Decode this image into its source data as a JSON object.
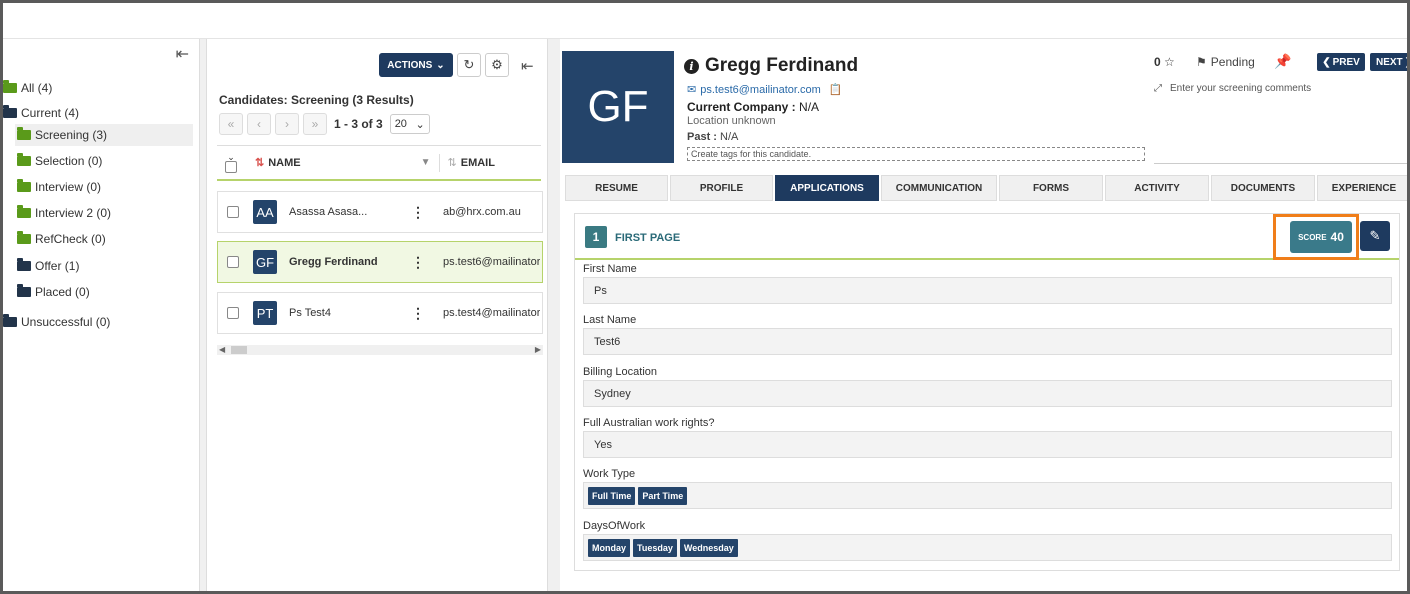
{
  "folders": {
    "items": [
      {
        "label": "All (4)",
        "color": "green"
      },
      {
        "label": "Current (4)",
        "color": "dark"
      },
      {
        "label": "Screening (3)",
        "color": "green",
        "active": true
      },
      {
        "label": "Selection (0)",
        "color": "green"
      },
      {
        "label": "Interview (0)",
        "color": "green"
      },
      {
        "label": "Interview 2 (0)",
        "color": "green"
      },
      {
        "label": "RefCheck (0)",
        "color": "green"
      },
      {
        "label": "Offer (1)",
        "color": "dark"
      },
      {
        "label": "Placed (0)",
        "color": "dark"
      },
      {
        "label": "Unsuccessful (0)",
        "color": "dark"
      }
    ]
  },
  "list": {
    "actions_label": "ACTIONS",
    "header": "Candidates: Screening (3 Results)",
    "pager_text": "1 - 3 of 3",
    "page_size": "20",
    "col_name": "NAME",
    "col_email": "EMAIL",
    "rows": [
      {
        "initials": "AA",
        "name": "Asassa Asasa...",
        "email": "ab@hrx.com.au"
      },
      {
        "initials": "GF",
        "name": "Gregg Ferdinand",
        "email": "ps.test6@mailinator"
      },
      {
        "initials": "PT",
        "name": "Ps Test4",
        "email": "ps.test4@mailinator"
      }
    ]
  },
  "profile": {
    "initials": "GF",
    "name": "Gregg Ferdinand",
    "email": "ps.test6@mailinator.com",
    "company_label": "Current Company :",
    "company_value": "N/A",
    "location": "Location unknown",
    "past_label": "Past :",
    "past_value": "N/A",
    "tags_placeholder": "Create tags for this candidate.",
    "rating": "0",
    "status": "Pending",
    "prev": "PREV",
    "next": "NEXT",
    "comments_placeholder": "Enter your screening comments"
  },
  "tabs": [
    "RESUME",
    "PROFILE",
    "APPLICATIONS",
    "COMMUNICATION",
    "FORMS",
    "ACTIVITY",
    "DOCUMENTS",
    "EXPERIENCE"
  ],
  "application": {
    "page_number": "1",
    "page_title": "FIRST PAGE",
    "score_label": "SCORE",
    "score_value": "40",
    "fields": [
      {
        "label": "First Name",
        "value": "Ps"
      },
      {
        "label": "Last Name",
        "value": "Test6"
      },
      {
        "label": "Billing Location",
        "value": "Sydney"
      },
      {
        "label": "Full Australian work rights?",
        "value": "Yes"
      },
      {
        "label": "Work Type",
        "chips": [
          "Full Time",
          "Part Time"
        ]
      },
      {
        "label": "DaysOfWork",
        "chips": [
          "Monday",
          "Tuesday",
          "Wednesday"
        ]
      }
    ]
  },
  "colors": {
    "navy": "#1e3a5f",
    "teal": "#3a7a8a",
    "highlight": "#f07e1a",
    "accent_green": "#b6d36b"
  }
}
